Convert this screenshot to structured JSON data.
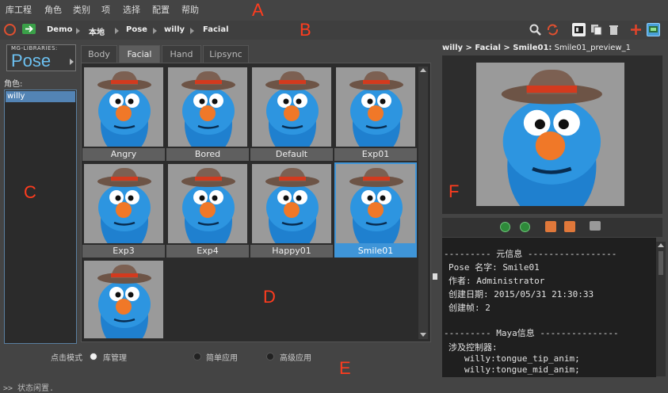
{
  "menu": [
    "库工程",
    "角色",
    "类别",
    "项",
    "选择",
    "配置",
    "帮助"
  ],
  "breadcrumb": [
    "Demo",
    "本地",
    "Pose",
    "willy",
    "Facial"
  ],
  "annotations": {
    "a": "A",
    "b": "B",
    "c": "C",
    "d": "D",
    "e": "E",
    "f": "F"
  },
  "logo": {
    "top": "MG-LIBRARIES:",
    "main": "Pose"
  },
  "role_label": "角色:",
  "roles": [
    "willy"
  ],
  "tabs": [
    "Body",
    "Facial",
    "Hand",
    "Lipsync"
  ],
  "active_tab": "Facial",
  "items": [
    "Angry",
    "Bored",
    "Default",
    "Exp01",
    "Exp3",
    "Exp4",
    "Happy01",
    "Smile01",
    ""
  ],
  "selected_item": "Smile01",
  "mode": {
    "label": "点击模式",
    "options": [
      "库管理",
      "简单应用",
      "高级应用"
    ],
    "selected": "库管理"
  },
  "status": ">> 状态闲置.",
  "preview": {
    "path": "willy > Facial > Smile01:",
    "name": "Smile01_preview_1"
  },
  "info": {
    "meta_header": "--------- 元信息 -----------------",
    "pose_name": "Pose 名字: Smile01",
    "author": "作者: Administrator",
    "created": "创建日期: 2015/05/31 21:30:33",
    "frame": "创建帧: 2",
    "maya_header": "--------- Maya信息 ---------------",
    "controllers_label": "涉及控制器:",
    "ctrl1": "willy:tongue_tip_anim;",
    "ctrl2": "willy:tongue_mid_anim;"
  },
  "colors": {
    "accent": "#3f95d8",
    "annotation": "#ff3c1e",
    "selection": "#5384b5"
  }
}
